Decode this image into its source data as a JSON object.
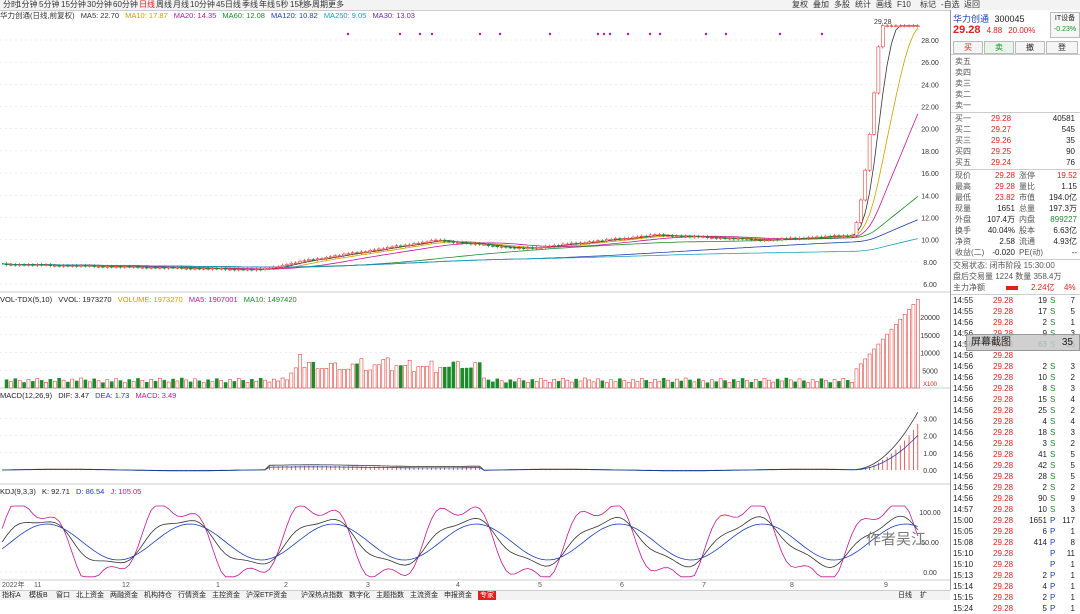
{
  "topbar": {
    "tabs": [
      "分时",
      "1分钟",
      "5分钟",
      "15分钟",
      "30分钟",
      "60分钟",
      "日线",
      "周线",
      "月线",
      "10分钟",
      "45日线",
      "季线",
      "年线",
      "5秒",
      "15秒",
      "多周期",
      "更多"
    ],
    "active_tab": "日线",
    "right_tools": [
      "复权",
      "叠加",
      "多股",
      "统计",
      "画线",
      "F10",
      "标记",
      "-自选",
      "返回"
    ]
  },
  "main_legend": {
    "title": "华力创通(日线,前复权)",
    "ma5": "MA5: 22.70",
    "ma10": "MA10: 17.87",
    "ma20": "MA20: 14.35",
    "ma60": "MA60: 12.08",
    "ma120": "MA120: 10.82",
    "ma250": "MA250: 9.05",
    "ma30": "MA30: 13.03",
    "y_ticks": [
      "28.00",
      "26.00",
      "24.00",
      "22.00",
      "20.00",
      "18.00",
      "16.00",
      "14.00",
      "12.00",
      "10.00",
      "8.00",
      "6.00"
    ],
    "high_label": "29.28"
  },
  "vol_legend": {
    "title": "VOL-TDX(5,10)",
    "vvol": "VVOL: 1973270",
    "volume": "VOLUME: 1973270",
    "ma5": "MA5: 1907001",
    "ma10": "MA10: 1497420",
    "y_ticks": [
      "20000",
      "15000",
      "10000",
      "5000"
    ],
    "unit": "X100"
  },
  "macd_legend": {
    "title": "MACD(12,26,9)",
    "dif": "DIF: 3.47",
    "dea": "DEA: 1.73",
    "macd": "MACD: 3.49",
    "y_ticks": [
      "3.00",
      "2.00",
      "1.00",
      "0.00"
    ]
  },
  "kdj_legend": {
    "title": "KDJ(9,3,3)",
    "k": "K: 92.71",
    "d": "D: 86.54",
    "j": "J: 105.05",
    "y_ticks": [
      "100.00",
      "50.00",
      "0.00"
    ]
  },
  "x_axis": [
    "2022年",
    "11",
    "12",
    "1",
    "2",
    "3",
    "4",
    "5",
    "6",
    "7",
    "8",
    "9"
  ],
  "bottombar": {
    "tabs": [
      "指标A",
      "模板B",
      "窗口",
      "北上资金",
      "两融资金",
      "机构持仓",
      "行情资金",
      "主控资金",
      "沪深ETF资金",
      "沪深热点指数",
      "数字化",
      "主题指数",
      "主流资金",
      "申报资金",
      "专家"
    ],
    "right": [
      "日线",
      "扩"
    ]
  },
  "quote": {
    "name": "华力创通",
    "code": "300045",
    "price": "29.28",
    "change": "4.88",
    "change_pct": "20.00%",
    "badge": "IT设备",
    "badge_pct": "-0.23%",
    "buttons": [
      "买",
      "卖",
      "撤",
      "登"
    ]
  },
  "asks": [
    {
      "label": "卖五",
      "price": "",
      "vol": ""
    },
    {
      "label": "卖四",
      "price": "",
      "vol": ""
    },
    {
      "label": "卖三",
      "price": "",
      "vol": ""
    },
    {
      "label": "卖二",
      "price": "",
      "vol": ""
    },
    {
      "label": "卖一",
      "price": "",
      "vol": ""
    }
  ],
  "bids": [
    {
      "label": "买一",
      "price": "29.28",
      "vol": "40581"
    },
    {
      "label": "买二",
      "price": "29.27",
      "vol": "545"
    },
    {
      "label": "买三",
      "price": "29.26",
      "vol": "35"
    },
    {
      "label": "买四",
      "price": "29.25",
      "vol": "90"
    },
    {
      "label": "买五",
      "price": "29.24",
      "vol": "76"
    }
  ],
  "stats": [
    {
      "l1": "现价",
      "v1": "29.28",
      "l2": "涨停",
      "v2": "19.52"
    },
    {
      "l1": "最高",
      "v1": "29.28",
      "l2": "量比",
      "v2": "1.15"
    },
    {
      "l1": "最低",
      "v1": "23.82",
      "l2": "市值",
      "v2": "194.0亿"
    },
    {
      "l1": "现量",
      "v1": "1651",
      "l2": "总量",
      "v2": "197.3万"
    },
    {
      "l1": "外盘",
      "v1": "107.4万",
      "l2": "内盘",
      "v2": "899227"
    },
    {
      "l1": "换手",
      "v1": "40.04%",
      "l2": "股本",
      "v2": "6.63亿"
    },
    {
      "l1": "净资",
      "v1": "2.58",
      "l2": "流通",
      "v2": "4.93亿"
    },
    {
      "l1": "收益(二)",
      "v1": "-0.020",
      "l2": "PE(动)",
      "v2": "--"
    }
  ],
  "trade_state": "交易状态: 闭市阶段 15:30:00",
  "auction": "盘后交易量 1224  数量 358.4万",
  "main_flow": {
    "label": "主力净额",
    "value": "2.24亿",
    "pct": "4%"
  },
  "ticks": [
    {
      "t": "14:55",
      "p": "29.28",
      "v": "19",
      "d": "S",
      "n": "7"
    },
    {
      "t": "14:55",
      "p": "29.28",
      "v": "17",
      "d": "S",
      "n": "5"
    },
    {
      "t": "14:56",
      "p": "29.28",
      "v": "2",
      "d": "S",
      "n": "1"
    },
    {
      "t": "14:56",
      "p": "29.28",
      "v": "9",
      "d": "S",
      "n": "3"
    },
    {
      "t": "14:56",
      "p": "29.28",
      "v": "63",
      "d": "S",
      "n": "36"
    },
    {
      "t": "14:56",
      "p": "29.28",
      "v": "",
      "d": "",
      "n": ""
    },
    {
      "t": "14:56",
      "p": "29.28",
      "v": "2",
      "d": "S",
      "n": "3"
    },
    {
      "t": "14:56",
      "p": "29.28",
      "v": "10",
      "d": "S",
      "n": "2"
    },
    {
      "t": "14:56",
      "p": "29.28",
      "v": "8",
      "d": "S",
      "n": "3"
    },
    {
      "t": "14:56",
      "p": "29.28",
      "v": "15",
      "d": "S",
      "n": "4"
    },
    {
      "t": "14:56",
      "p": "29.28",
      "v": "25",
      "d": "S",
      "n": "2"
    },
    {
      "t": "14:56",
      "p": "29.28",
      "v": "4",
      "d": "S",
      "n": "4"
    },
    {
      "t": "14:56",
      "p": "29.28",
      "v": "18",
      "d": "S",
      "n": "3"
    },
    {
      "t": "14:56",
      "p": "29.28",
      "v": "3",
      "d": "S",
      "n": "2"
    },
    {
      "t": "14:56",
      "p": "29.28",
      "v": "41",
      "d": "S",
      "n": "5"
    },
    {
      "t": "14:56",
      "p": "29.28",
      "v": "42",
      "d": "S",
      "n": "5"
    },
    {
      "t": "14:56",
      "p": "29.28",
      "v": "28",
      "d": "S",
      "n": "5"
    },
    {
      "t": "14:56",
      "p": "29.28",
      "v": "2",
      "d": "S",
      "n": "2"
    },
    {
      "t": "14:56",
      "p": "29.28",
      "v": "90",
      "d": "S",
      "n": "9"
    },
    {
      "t": "14:57",
      "p": "29.28",
      "v": "10",
      "d": "S",
      "n": "3"
    },
    {
      "t": "15:00",
      "p": "29.28",
      "v": "1651",
      "d": "P",
      "n": "117"
    },
    {
      "t": "15:05",
      "p": "29.28",
      "v": "6",
      "d": "P",
      "n": "1"
    },
    {
      "t": "15:08",
      "p": "29.28",
      "v": "414",
      "d": "P",
      "n": "8"
    },
    {
      "t": "15:10",
      "p": "29.28",
      "v": "",
      "d": "P",
      "n": "11"
    },
    {
      "t": "15:10",
      "p": "29.28",
      "v": "",
      "d": "P",
      "n": "1"
    },
    {
      "t": "15:13",
      "p": "29.28",
      "v": "2",
      "d": "P",
      "n": "1"
    },
    {
      "t": "15:14",
      "p": "29.28",
      "v": "4",
      "d": "P",
      "n": "1"
    },
    {
      "t": "15:15",
      "p": "29.28",
      "v": "2",
      "d": "P",
      "n": "1"
    },
    {
      "t": "15:24",
      "p": "29.28",
      "v": "5",
      "d": "P",
      "n": "1"
    }
  ],
  "overlay": {
    "label": "屏幕截图",
    "value": "35"
  },
  "watermark": "作者吴江",
  "colors": {
    "up": "#e0201b",
    "down": "#1a8b2b",
    "accent": "#1a3fb5"
  }
}
